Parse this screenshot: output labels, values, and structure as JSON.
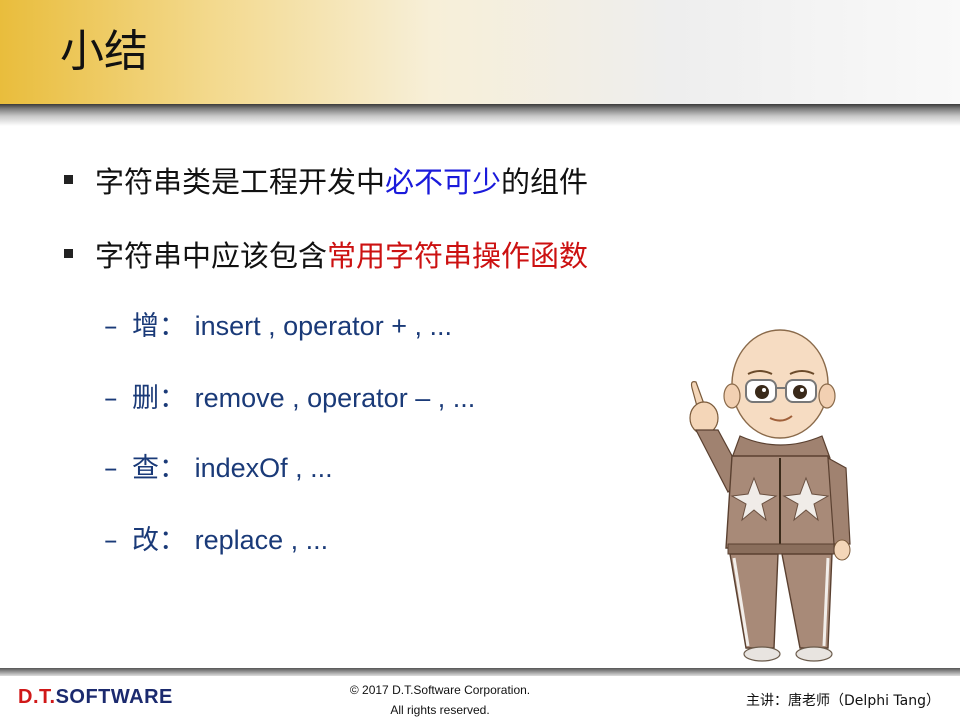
{
  "slide": {
    "title": "小结",
    "bullets": [
      {
        "prefix": "字符串类是工程开发中",
        "highlight": "必不可少",
        "suffix": "的组件",
        "highlight_color": "#1a1adb"
      },
      {
        "prefix": "字符串中应该包含",
        "highlight": "常用字符串操作函数",
        "suffix": "",
        "highlight_color": "#cc1111"
      }
    ],
    "sub_items": [
      {
        "label": "增：",
        "ops": "insert , operator + , ..."
      },
      {
        "label": "删：",
        "ops": "remove , operator – , ..."
      },
      {
        "label": "查：",
        "ops": "indexOf , ..."
      },
      {
        "label": "改：",
        "ops": "replace , ..."
      }
    ],
    "dash": "–"
  },
  "footer": {
    "logo_main": "D.T.",
    "logo_brand": "SOFTWARE",
    "copyright_line1": "© 2017 D.T.Software Corporation.",
    "copyright_line2": "All rights reserved.",
    "speaker": "主讲：唐老师（Delphi Tang）"
  },
  "colors": {
    "title_band": "#e9bd3c",
    "sub_text": "#1a3a78"
  },
  "icons": {
    "bullet": "square-bullet-icon",
    "mascot": "teacher-mascot-illustration"
  }
}
